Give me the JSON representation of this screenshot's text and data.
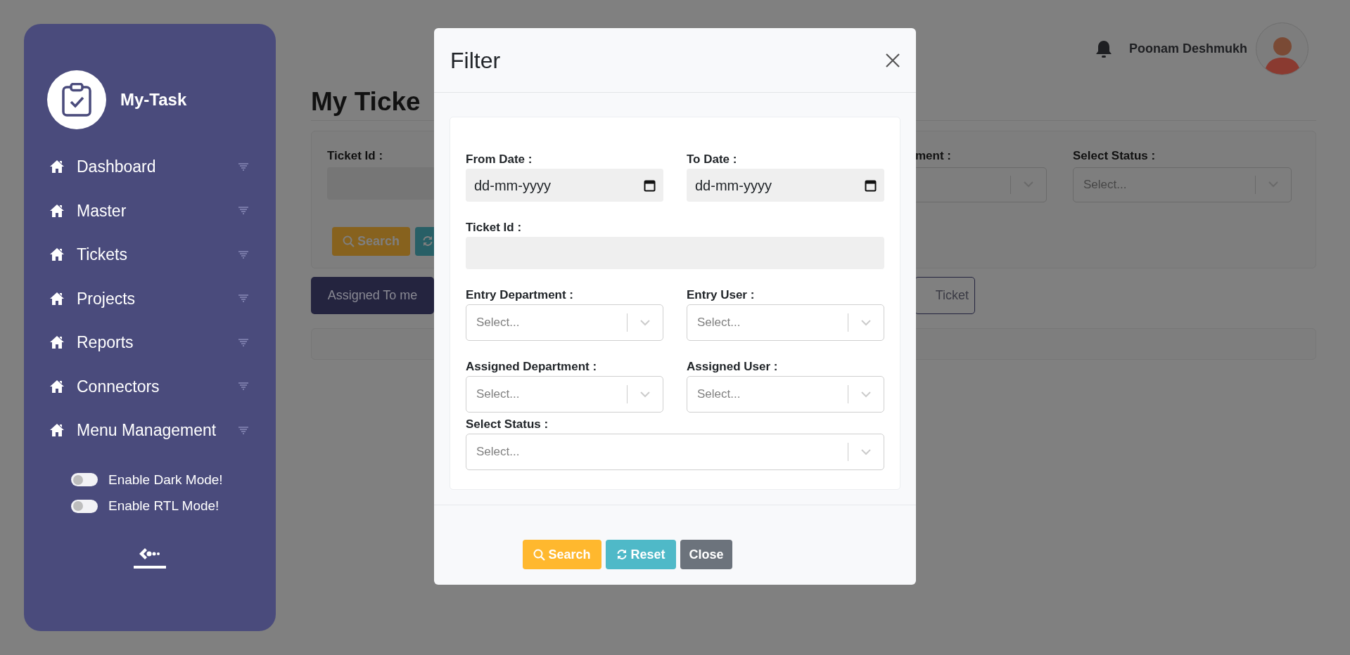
{
  "sidebar": {
    "brand": "My-Task",
    "menu": [
      {
        "label": "Dashboard"
      },
      {
        "label": "Master"
      },
      {
        "label": "Tickets"
      },
      {
        "label": "Projects"
      },
      {
        "label": "Reports"
      },
      {
        "label": "Connectors"
      },
      {
        "label": "Menu Management"
      }
    ],
    "toggles": [
      {
        "label": "Enable Dark Mode!",
        "on": false
      },
      {
        "label": "Enable RTL Mode!",
        "on": false
      }
    ]
  },
  "header": {
    "user_name": "Poonam Deshmukh"
  },
  "page": {
    "title": "My Ticke",
    "filter": {
      "ticket_id_label": "Ticket Id :",
      "department_label": "ment :",
      "status_label": "Select Status :",
      "status_placeholder": "Select...",
      "search_button": "Search"
    },
    "tabs": [
      {
        "label": "Assigned To me",
        "selected": true
      },
      {
        "label": "Ticket",
        "selected": false
      }
    ]
  },
  "dialog": {
    "title": "Filter",
    "fields": [
      {
        "kind": "date",
        "label": "From Date :",
        "placeholder": "dd-mm-yyyy",
        "wide": false
      },
      {
        "kind": "date",
        "label": "To Date :",
        "placeholder": "dd-mm-yyyy",
        "wide": false
      },
      {
        "kind": "text",
        "label": "Ticket Id :",
        "wide": true
      },
      {
        "kind": "select",
        "label": "Entry Department :",
        "placeholder": "Select...",
        "wide": false
      },
      {
        "kind": "select",
        "label": "Entry User :",
        "placeholder": "Select...",
        "wide": false
      },
      {
        "kind": "select",
        "label": "Assigned Department :",
        "placeholder": "Select...",
        "wide": false
      },
      {
        "kind": "select",
        "label": "Assigned User :",
        "placeholder": "Select...",
        "wide": false
      },
      {
        "kind": "select",
        "label": "Select Status :",
        "placeholder": "Select...",
        "wide": true
      }
    ],
    "buttons": [
      {
        "kind": "search",
        "label": "Search"
      },
      {
        "kind": "reset",
        "label": "Reset"
      },
      {
        "kind": "close",
        "label": "Close"
      }
    ]
  }
}
